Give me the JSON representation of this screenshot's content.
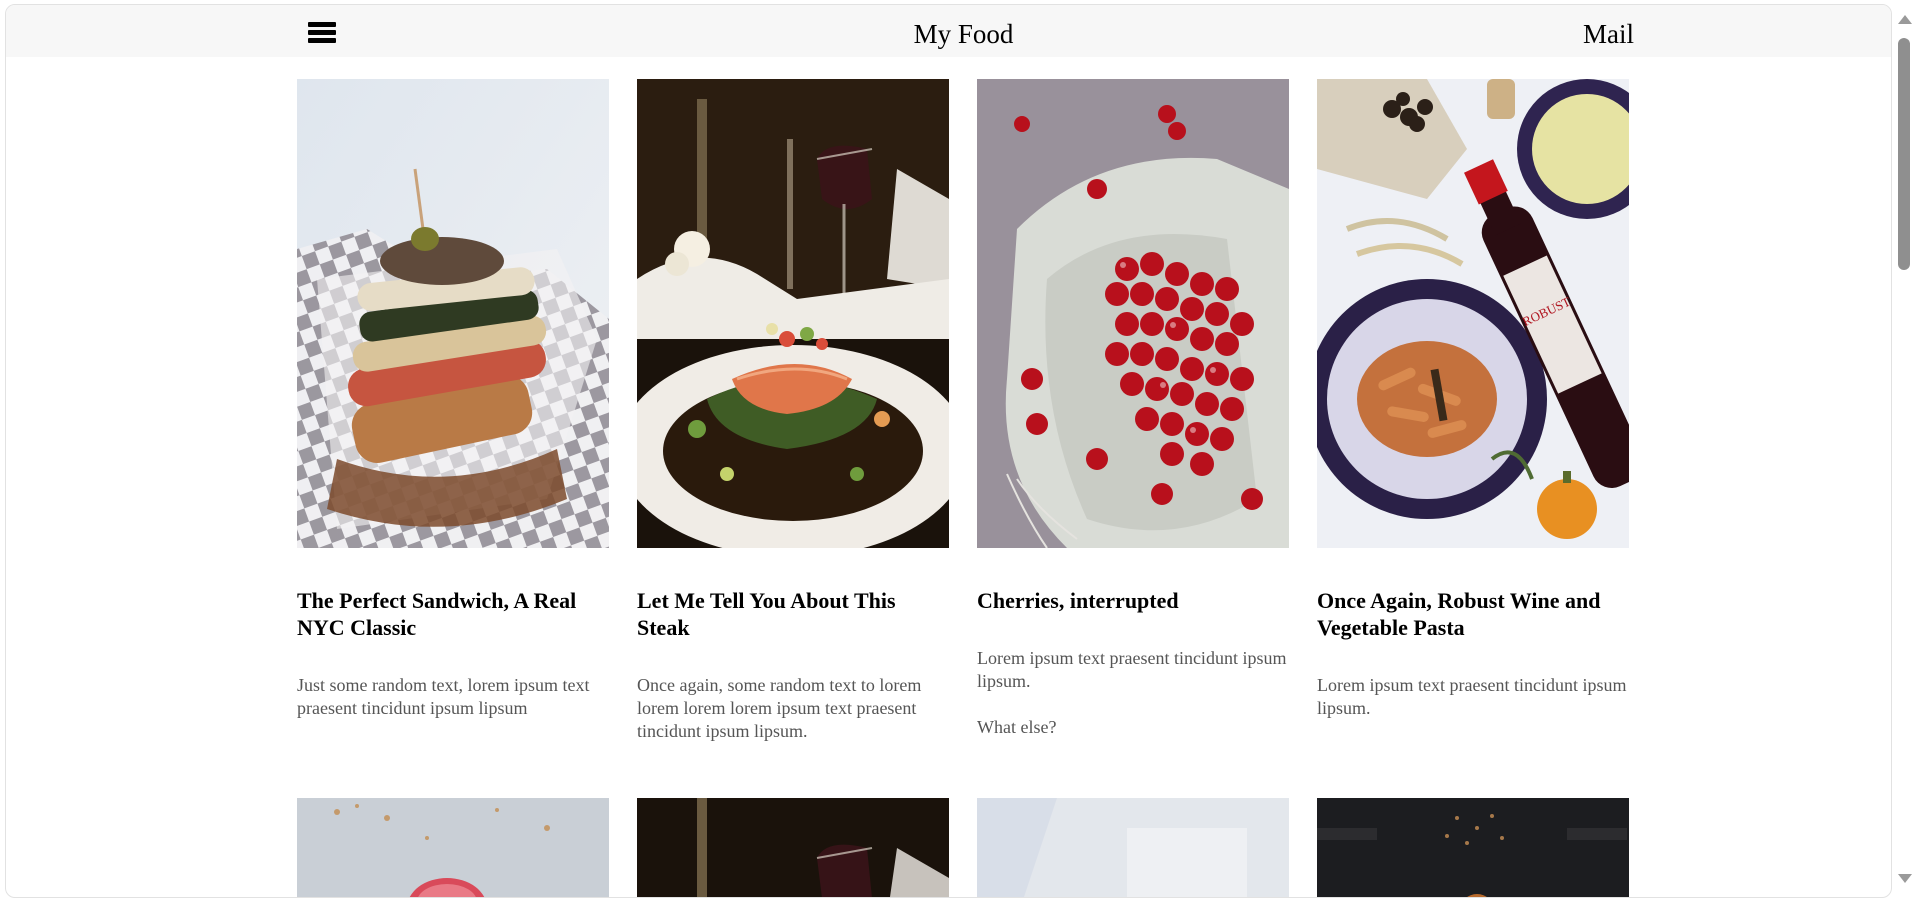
{
  "header": {
    "title": "My Food",
    "mail_label": "Mail"
  },
  "cards": [
    {
      "title": "The Perfect Sandwich, A Real NYC Classic",
      "text": "Just some random text, lorem ipsum text praesent tincidunt ipsum lipsum"
    },
    {
      "title": "Let Me Tell You About This Steak",
      "text": "Once again, some random text to lorem lorem lorem lorem ipsum text praesent tincidunt ipsum lipsum."
    },
    {
      "title": "Cherries, interrupted",
      "text": "Lorem ipsum text praesent tincidunt ipsum lipsum.",
      "extra": "What else?"
    },
    {
      "title": "Once Again, Robust Wine and Vegetable Pasta",
      "text": "Lorem ipsum text praesent tincidunt ipsum lipsum."
    }
  ],
  "photos": {
    "sandwich": "sandwich-photo",
    "salmon": "salmon-dish-photo",
    "cherries": "cherries-photo",
    "wine_pasta": "wine-pasta-photo"
  }
}
